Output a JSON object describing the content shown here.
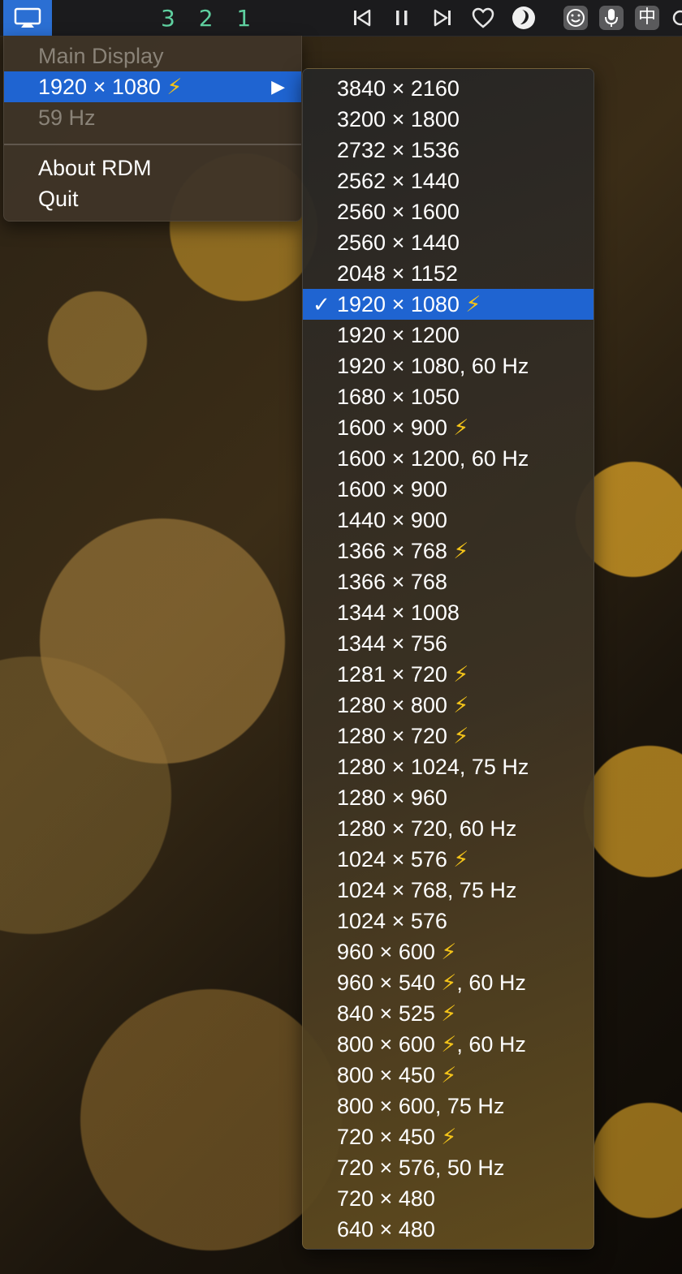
{
  "menubar": {
    "countdown": "3 2 1",
    "icons": [
      "display-icon",
      "skip-back-icon",
      "pause-icon",
      "skip-forward-icon",
      "heart-icon",
      "moon-icon",
      "emoji-icon",
      "microphone-icon",
      "chinese-input-icon"
    ],
    "input_method_label": "中"
  },
  "main_menu": {
    "items": [
      {
        "label": "Main Display",
        "disabled": true
      },
      {
        "label": "1920 × 1080",
        "bolt": "⚡",
        "submenu_arrow": "▶",
        "selected": true
      },
      {
        "label": "59 Hz",
        "disabled": true
      },
      {
        "label": "About RDM"
      },
      {
        "label": "Quit"
      }
    ]
  },
  "submenu": {
    "checkmark": "✓",
    "items": [
      {
        "res": "3840 × 2160",
        "bolt": "",
        "hz": ""
      },
      {
        "res": "3200 × 1800",
        "bolt": "",
        "hz": ""
      },
      {
        "res": "2732 × 1536",
        "bolt": "",
        "hz": ""
      },
      {
        "res": "2562 × 1440",
        "bolt": "",
        "hz": ""
      },
      {
        "res": "2560 × 1600",
        "bolt": "",
        "hz": ""
      },
      {
        "res": "2560 × 1440",
        "bolt": "",
        "hz": ""
      },
      {
        "res": "2048 × 1152",
        "bolt": "",
        "hz": ""
      },
      {
        "res": "1920 × 1080",
        "bolt": " ⚡",
        "hz": "",
        "selected": true
      },
      {
        "res": "1920 × 1200",
        "bolt": "",
        "hz": ""
      },
      {
        "res": "1920 × 1080, 60 Hz",
        "bolt": "",
        "hz": ""
      },
      {
        "res": "1680 × 1050",
        "bolt": "",
        "hz": ""
      },
      {
        "res": "1600 × 900",
        "bolt": " ⚡",
        "hz": ""
      },
      {
        "res": "1600 × 1200, 60 Hz",
        "bolt": "",
        "hz": ""
      },
      {
        "res": "1600 × 900",
        "bolt": "",
        "hz": ""
      },
      {
        "res": "1440 × 900",
        "bolt": "",
        "hz": ""
      },
      {
        "res": "1366 × 768",
        "bolt": " ⚡",
        "hz": ""
      },
      {
        "res": "1366 × 768",
        "bolt": "",
        "hz": ""
      },
      {
        "res": "1344 × 1008",
        "bolt": "",
        "hz": ""
      },
      {
        "res": "1344 × 756",
        "bolt": "",
        "hz": ""
      },
      {
        "res": "1281 × 720",
        "bolt": " ⚡",
        "hz": ""
      },
      {
        "res": "1280 × 800",
        "bolt": " ⚡",
        "hz": ""
      },
      {
        "res": "1280 × 720",
        "bolt": " ⚡",
        "hz": ""
      },
      {
        "res": "1280 × 1024, 75 Hz",
        "bolt": "",
        "hz": ""
      },
      {
        "res": "1280 × 960",
        "bolt": "",
        "hz": ""
      },
      {
        "res": "1280 × 720, 60 Hz",
        "bolt": "",
        "hz": ""
      },
      {
        "res": "1024 × 576",
        "bolt": " ⚡",
        "hz": ""
      },
      {
        "res": "1024 × 768, 75 Hz",
        "bolt": "",
        "hz": ""
      },
      {
        "res": "1024 × 576",
        "bolt": "",
        "hz": ""
      },
      {
        "res": "960 × 600",
        "bolt": " ⚡",
        "hz": ""
      },
      {
        "res": "960 × 540",
        "bolt": " ⚡",
        "hz": ", 60 Hz"
      },
      {
        "res": "840 × 525",
        "bolt": " ⚡",
        "hz": ""
      },
      {
        "res": "800 × 600",
        "bolt": " ⚡",
        "hz": ", 60 Hz"
      },
      {
        "res": "800 × 450",
        "bolt": " ⚡",
        "hz": ""
      },
      {
        "res": "800 × 600, 75 Hz",
        "bolt": "",
        "hz": ""
      },
      {
        "res": "720 × 450",
        "bolt": " ⚡",
        "hz": ""
      },
      {
        "res": "720 × 576, 50 Hz",
        "bolt": "",
        "hz": ""
      },
      {
        "res": "720 × 480",
        "bolt": "",
        "hz": ""
      },
      {
        "res": "640 × 480",
        "bolt": "",
        "hz": ""
      }
    ]
  },
  "colors": {
    "selection": "#1f64d1",
    "bolt": "#f3c319",
    "countdown": "#5fd0a0"
  }
}
